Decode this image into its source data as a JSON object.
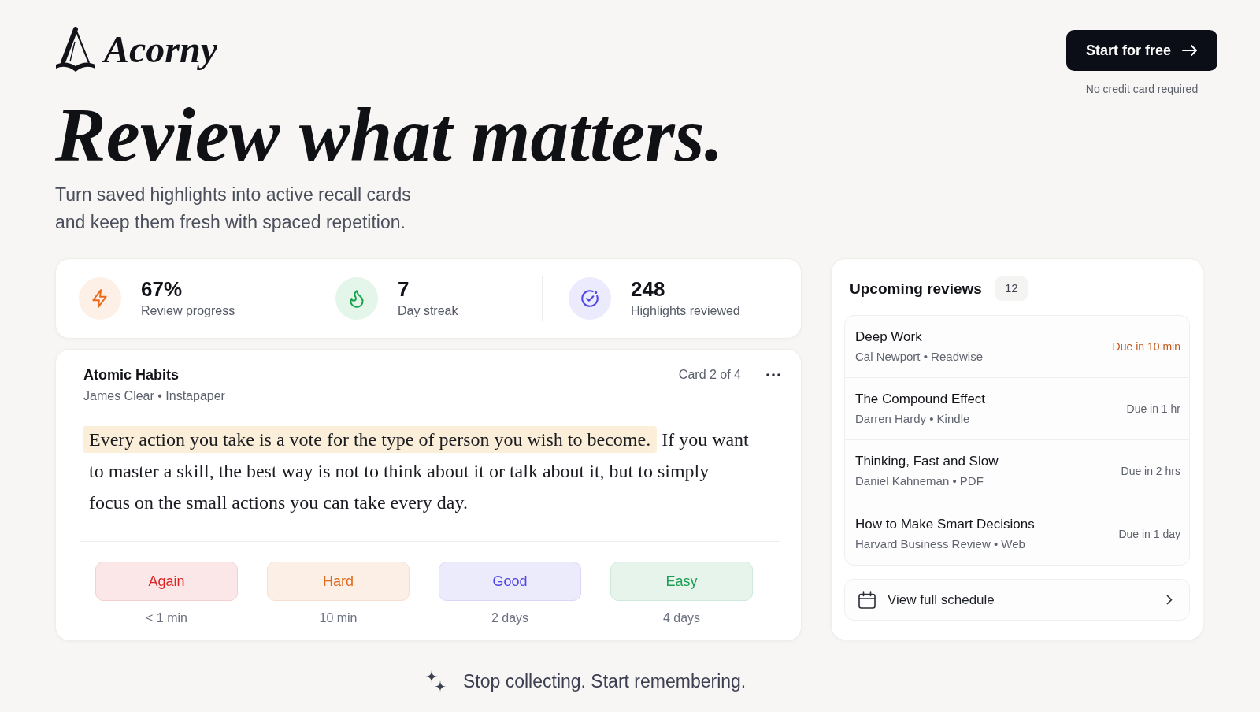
{
  "brand": {
    "name": "Acorny"
  },
  "cta": {
    "label": "Start for free",
    "note": "No credit card required"
  },
  "hero": {
    "headline": "Review what matters.",
    "subtitle": "Turn saved highlights into active recall cards\nand keep them fresh with spaced repetition."
  },
  "stats": [
    {
      "value": "67%",
      "label": "Review progress"
    },
    {
      "value": "7",
      "label": "Day streak"
    },
    {
      "value": "248",
      "label": "Highlights reviewed"
    }
  ],
  "card": {
    "title": "Atomic Habits",
    "meta": "James Clear • Instapaper",
    "position": "Card 2 of 4",
    "highlight": "Every action you take is a vote for the type of person you wish to become.",
    "text": "If you want to master a skill, the best way is not to think about it or talk about it, but to simply focus on the small actions you can take every day."
  },
  "grades": [
    {
      "label": "Again",
      "interval": "< 1 min",
      "color": "#dc2626"
    },
    {
      "label": "Hard",
      "interval": "10 min",
      "color": "#dd6a1f"
    },
    {
      "label": "Good",
      "interval": "2 days",
      "color": "#5046e5"
    },
    {
      "label": "Easy",
      "interval": "4 days",
      "color": "#1f9d55"
    }
  ],
  "upcoming": {
    "title": "Upcoming reviews",
    "count": "12",
    "items": [
      {
        "title": "Deep Work",
        "meta": "Cal Newport • Readwise",
        "due": "Due in 10 min",
        "urgent": true
      },
      {
        "title": "The Compound Effect",
        "meta": "Darren Hardy • Kindle",
        "due": "Due in 1 hr",
        "urgent": false
      },
      {
        "title": "Thinking, Fast and Slow",
        "meta": "Daniel Kahneman • PDF",
        "due": "Due in 2 hrs",
        "urgent": false
      },
      {
        "title": "How to Make Smart Decisions",
        "meta": "Harvard Business Review • Web",
        "due": "Due in 1 day",
        "urgent": false
      }
    ],
    "schedule_link": "View full schedule"
  },
  "tagline": "Stop collecting. Start remembering."
}
